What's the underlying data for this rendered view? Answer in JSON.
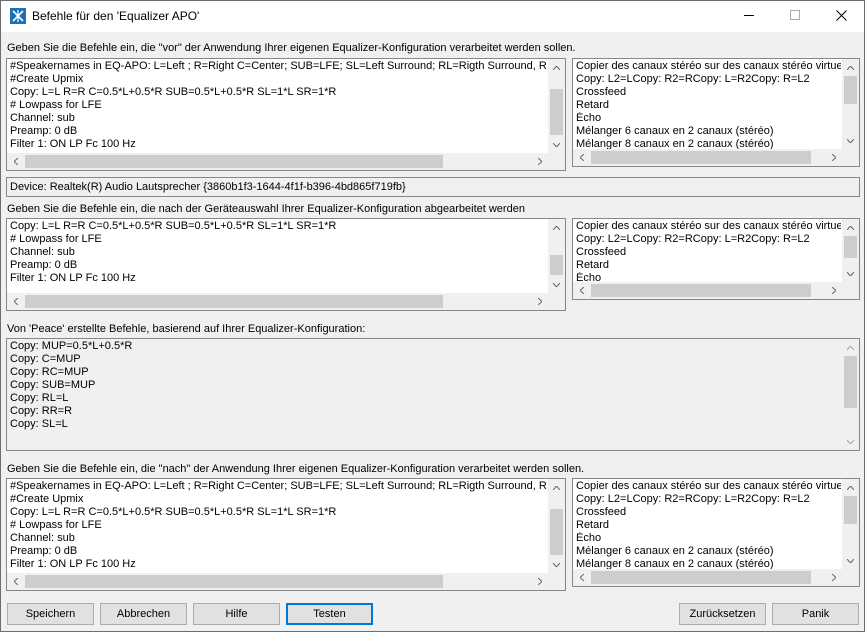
{
  "window": {
    "title": "Befehle für den 'Equalizer APO'"
  },
  "section_before": {
    "label": "Geben Sie die Befehle ein, die \"vor\" der Anwendung Ihrer eigenen Equalizer-Konfiguration verarbeitet werden sollen.",
    "lines": [
      "#Speakernames in EQ-APO: L=Left ; R=Right C=Center; SUB=LFE; SL=Left Surround; RL=Rigth Surround, RL=Re",
      "#Create Upmix",
      "Copy: L=L R=R C=0.5*L+0.5*R SUB=0.5*L+0.5*R SL=1*L SR=1*R",
      "# Lowpass for LFE",
      "Channel: sub",
      "Preamp: 0 dB",
      "Filter 1: ON LP Fc 100 Hz"
    ],
    "presets": [
      "Copier des canaux stéréo sur des canaux stéréo virtuels",
      "Copy: L2=LCopy: R2=RCopy: L=R2Copy: R=L2",
      "Crossfeed",
      "Retard",
      "Écho",
      "Mélanger 6 canaux en 2 canaux (stéréo)",
      "Mélanger 8 canaux en 2 canaux (stéréo)"
    ]
  },
  "device": {
    "text": "Device: Realtek(R) Audio Lautsprecher {3860b1f3-1644-4f1f-b396-4bd865f719fb}"
  },
  "section_after_device": {
    "label": "Geben Sie die Befehle ein, die nach der Geräteauswahl Ihrer Equalizer-Konfiguration abgearbeitet werden",
    "lines": [
      "Copy: L=L R=R C=0.5*L+0.5*R SUB=0.5*L+0.5*R SL=1*L SR=1*R",
      "# Lowpass for LFE",
      "Channel: sub",
      "Preamp: 0 dB",
      "Filter 1: ON LP Fc 100 Hz"
    ],
    "presets": [
      "Copier des canaux stéréo sur des canaux stéréo virtuels",
      "Copy: L2=LCopy: R2=RCopy: L=R2Copy: R=L2",
      "Crossfeed",
      "Retard",
      "Écho"
    ]
  },
  "section_peace": {
    "label": "Von 'Peace' erstellte Befehle, basierend auf Ihrer Equalizer-Konfiguration:",
    "lines": [
      "Copy: MUP=0.5*L+0.5*R",
      "Copy: C=MUP",
      "Copy: RC=MUP",
      "Copy: SUB=MUP",
      "Copy: RL=L",
      "Copy: RR=R",
      "Copy: SL=L"
    ]
  },
  "section_after": {
    "label": "Geben Sie die Befehle ein, die \"nach\" der Anwendung Ihrer eigenen Equalizer-Konfiguration verarbeitet werden sollen.",
    "lines": [
      "#Speakernames in EQ-APO: L=Left ; R=Right C=Center; SUB=LFE; SL=Left Surround; RL=Rigth Surround, RL=Re",
      "#Create Upmix",
      "Copy: L=L R=R C=0.5*L+0.5*R SUB=0.5*L+0.5*R SL=1*L SR=1*R",
      "# Lowpass for LFE",
      "Channel: sub",
      "Preamp: 0 dB",
      "Filter 1: ON LP Fc 100 Hz"
    ],
    "presets": [
      "Copier des canaux stéréo sur des canaux stéréo virtuels",
      "Copy: L2=LCopy: R2=RCopy: L=R2Copy: R=L2",
      "Crossfeed",
      "Retard",
      "Écho",
      "Mélanger 6 canaux en 2 canaux (stéréo)",
      "Mélanger 8 canaux en 2 canaux (stéréo)"
    ]
  },
  "buttons": {
    "save": "Speichern",
    "cancel": "Abbrechen",
    "help": "Hilfe",
    "test": "Testen",
    "reset": "Zurücksetzen",
    "panic": "Panik"
  },
  "colors": {
    "accent": "#0078d7",
    "icon": "#1c6fb8"
  },
  "icons": {
    "app": "equalizer-apo-icon",
    "minimize": "minimize-icon",
    "maximize": "maximize-icon",
    "close": "close-icon"
  }
}
